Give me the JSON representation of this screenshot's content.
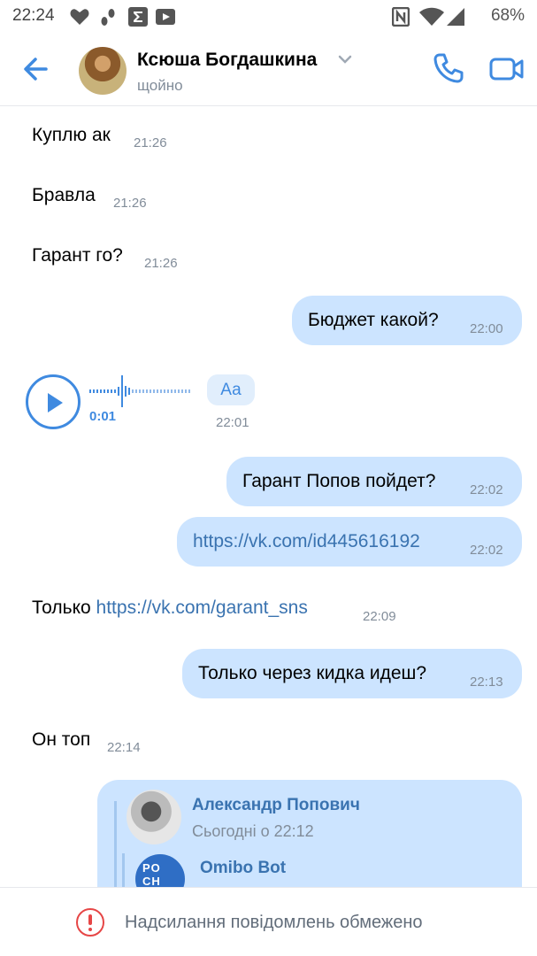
{
  "status_bar": {
    "time": "22:24",
    "battery": "68%",
    "left_icons": [
      "heart-icon",
      "steps-icon",
      "sigma-icon",
      "video-camera-icon"
    ],
    "right_icons": [
      "nfc-icon",
      "wifi-icon",
      "signal-icon"
    ]
  },
  "header": {
    "name": "Ксюша Богдашкина",
    "status": "щойно",
    "accent": "#3f8ae0"
  },
  "messages": {
    "m1": {
      "text": "Куплю ак",
      "time": "21:26"
    },
    "m2": {
      "text": "Бравла",
      "time": "21:26"
    },
    "m3": {
      "text": "Гарант го?",
      "time": "21:26"
    },
    "m4": {
      "text": "Бюджет какой?",
      "time": "22:00"
    },
    "voice": {
      "duration": "0:01",
      "transcribe_label": "Аа",
      "time": "22:01"
    },
    "m6": {
      "text": "Гарант Попов пойдет?",
      "time": "22:02"
    },
    "m7": {
      "text": "https://vk.com/id445616192",
      "time": "22:02"
    },
    "m8": {
      "text": "Только",
      "link": "https://vk.com/garant_sns",
      "time": "22:09"
    },
    "m9": {
      "text": "Только через кидка идеш?",
      "time": "22:13"
    },
    "m10": {
      "text": "Он топ",
      "time": "22:14"
    },
    "forwarded": {
      "author": "Александр Попович",
      "date": "Сьогодні о 22:12",
      "nested_author": "Omibo Bot",
      "nested_avatar_text": "PO\nCH"
    }
  },
  "bottom_bar": {
    "text": "Надсилання повідомлень обмежено"
  },
  "colors": {
    "outgoing_bubble": "#cce4ff",
    "link": "#3a73b0",
    "time": "#818c99",
    "warning": "#e64646"
  }
}
